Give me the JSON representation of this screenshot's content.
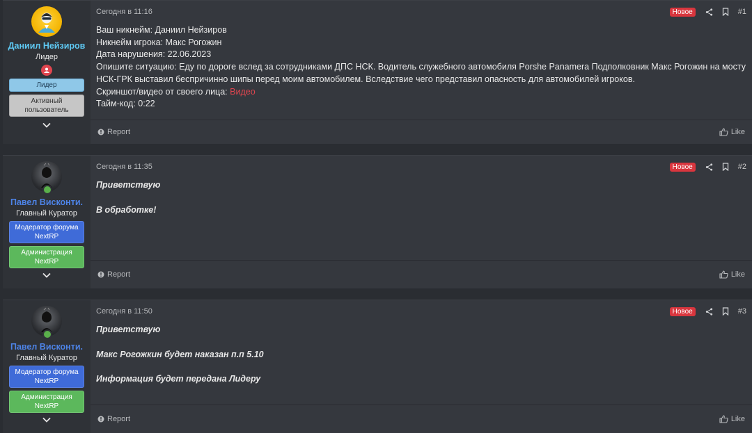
{
  "posts": [
    {
      "user": {
        "name": "Даниил Нейзиров",
        "title": "Лидер",
        "banners": [
          "Лидер",
          "Активный пользователь"
        ]
      },
      "time": "Сегодня в 11:16",
      "badge": "Новое",
      "number": "#1",
      "lines": [
        "Ваш никнейм: Даниил Нейзиров",
        "Никнейм игрока: Макс Рогожин",
        "Дата нарушения: 22.06.2023",
        "Опишите ситуацию: Еду по дороге вслед за сотрудниками ДПС НСК. Водитель служебного автомобиля Porshe Panamera Подполковник Макс Рогожин на мосту НСК-ГРК выставил беспричинно шипы перед моим автомобилем. Вследствие чего представил опасность для автомобилей игроков."
      ],
      "screenshot_label": "Скриншот/видео от своего лица:",
      "screenshot_link": "Видео",
      "timecode": "Тайм-код: 0:22",
      "report": "Report",
      "like": "Like"
    },
    {
      "user": {
        "name": "Павел Висконти.",
        "title": "Главный Куратор",
        "banners": [
          "Модератор форума NextRP",
          "Администрация NextRP"
        ]
      },
      "time": "Сегодня в 11:35",
      "badge": "Новое",
      "number": "#2",
      "lines": [
        "Приветствую",
        "В обработке!"
      ],
      "report": "Report",
      "like": "Like"
    },
    {
      "user": {
        "name": "Павел Висконти.",
        "title": "Главный Куратор",
        "banners": [
          "Модератор форума NextRP",
          "Администрация NextRP"
        ]
      },
      "time": "Сегодня в 11:50",
      "badge": "Новое",
      "number": "#3",
      "lines": [
        "Приветствую",
        "Макс Рогожкин будет наказан п.п 5.10",
        "Информация будет передана Лидеру"
      ],
      "report": "Report",
      "like": "Like"
    }
  ],
  "colors": {
    "background": "#2a2d32",
    "post_bg": "#35383e",
    "user_bg": "#2f3237",
    "new_badge": "#d9363e",
    "leader_name": "#5ec8f2",
    "moderator_name": "#4d83e6",
    "online": "#5ab04b"
  },
  "icons": [
    "share-icon",
    "bookmark-icon",
    "report-icon",
    "like-icon",
    "chevron-down-icon",
    "online-indicator",
    "leader-role-icon"
  ]
}
